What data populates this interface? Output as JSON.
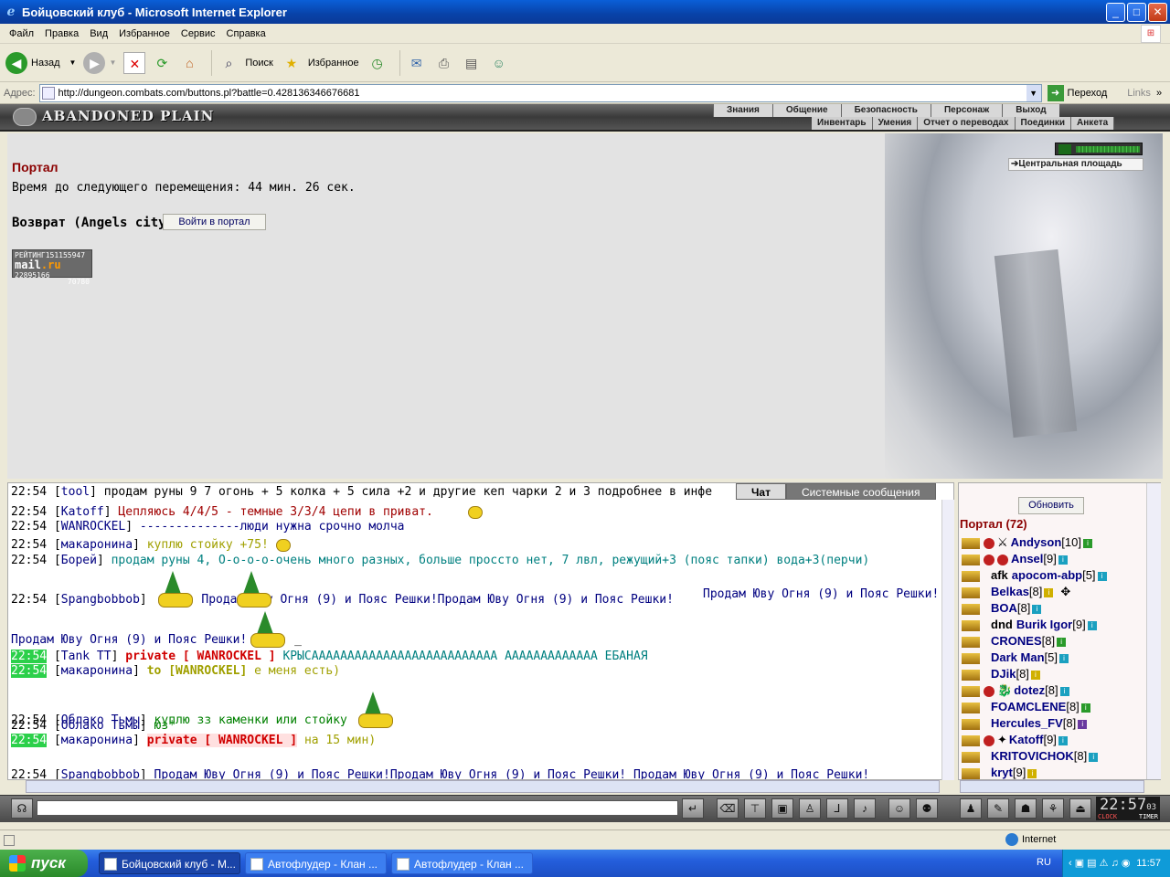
{
  "window": {
    "title": "Бойцовский клуб - Microsoft Internet Explorer",
    "min": "_",
    "max": "□",
    "close": "✕"
  },
  "menu": [
    "Файл",
    "Правка",
    "Вид",
    "Избранное",
    "Сервис",
    "Справка"
  ],
  "toolbar": {
    "back": "Назад",
    "search": "Поиск",
    "favorites": "Избранное"
  },
  "address": {
    "label": "Адрес:",
    "url": "http://dungeon.combats.com/buttons.pl?battle=0.428136346676681",
    "go": "Переход",
    "links": "Links"
  },
  "game": {
    "logo": "ABANDONED PLAIN",
    "nav_top": [
      "Знания",
      "Общение",
      "Безопасность",
      "Персонаж",
      "Выход"
    ],
    "nav_bottom": [
      "Инвентарь",
      "Умения",
      "Отчет о переводах",
      "Поединки",
      "Анкета"
    ]
  },
  "main": {
    "title": "Портал",
    "time_text": "Время до следующего перемещения: 44 мин. 26 сек.",
    "return_label": "Возврат (Angels city)",
    "portal_button": "Войти в портал",
    "central_link": "Центральная площадь",
    "counter": {
      "rating": "РЕЙТИНГ",
      "num1": "151155947",
      "brand": "mail",
      "brand_ru": ".ru",
      "num2": "22895166",
      "num3": "70780"
    }
  },
  "chat": {
    "tab_chat": "Чат",
    "tab_system": "Системные сообщения",
    "lines": [
      {
        "time": "22:54",
        "nick": "tool",
        "text": "продам руны 9 7 огонь + 5 колка + 5 сила +2 и другие кеп чарки 2 и 3 подробнее в инфе",
        "color": "#000000"
      },
      {
        "time": "22:54",
        "nick": "Katoff",
        "text": "Цепляюсь 4/4/5 - темные 3/3/4 цепи в приват.",
        "color": "#a00000"
      },
      {
        "time": "22:54",
        "nick": "WANROCKEL",
        "text": "--------------люди нужна срочно молча",
        "color": "#000080"
      },
      {
        "time": "22:54",
        "nick": "макаронина",
        "text": "куплю стойку +75!",
        "color": "#a0a000"
      },
      {
        "time": "22:54",
        "nick": "Борей",
        "text": "продам руны 4, О-о-о-о-очень много разных, больше проссто нет, 7 лвл, режущий+3 (пояс тапки) вода+3(перчи)",
        "color": "#008080"
      },
      {
        "time": "22:54",
        "nick": "Spangbobbob",
        "text": "Продам Юву Огня (9) и Пояс Решки!Продам Юву Огня (9) и Пояс Решки!",
        "text2": "Продам Юву Огня (9) и Пояс Решки!",
        "color": "#000080"
      },
      {
        "text": "Продам Юву Огня (9) и Пояс Решки!",
        "tail": "_",
        "color": "#000080"
      },
      {
        "time": "22:54",
        "nick": "Tank TT",
        "private": "private [ WANROCKEL ]",
        "text": "КРЫСАААААААААААААААААААААААААА ААААААААААААА ЕБАНАЯ",
        "color": "#008080"
      },
      {
        "time": "22:54",
        "nick": "макаронина",
        "to": "to [WANROCKEL]",
        "text": "е меня есть)",
        "color": "#a0a000"
      },
      {
        "time": "22:54",
        "nick": "Облако Тьмы",
        "text": "куплю зз каменки или стойку",
        "color": "#008000"
      },
      {
        "time": "22:54",
        "nick": "Облако Тьмы",
        "text": "юз*",
        "color": "#008000"
      },
      {
        "time": "22:54",
        "nick": "макаронина",
        "private": "private [ WANROCKEL ]",
        "text": "на 15 мин)",
        "color": "#a0a000"
      },
      {
        "time": "22:54",
        "nick": "Spangbobbob",
        "text": "Продам Юву Огня (9) и Пояс Решки!Продам Юву Огня (9) и Пояс Решки!",
        "text2": "Продам Юву Огня (9) и Пояс Решки!",
        "color": "#000080"
      }
    ]
  },
  "online": {
    "refresh": "Обновить",
    "title": "Портал (72)",
    "users": [
      {
        "name": "Andyson",
        "level": "[10]"
      },
      {
        "name": "Ansel",
        "level": "[9]"
      },
      {
        "status": "afk",
        "name": "apocom-abp",
        "level": "[5]"
      },
      {
        "name": "Belkas",
        "level": "[8]"
      },
      {
        "name": "BOA",
        "level": "[8]"
      },
      {
        "status": "dnd",
        "name": "Burik Igor",
        "level": "[9]"
      },
      {
        "name": "CRONES",
        "level": "[8]"
      },
      {
        "name": "Dark Man",
        "level": "[5]"
      },
      {
        "name": "DJik",
        "level": "[8]"
      },
      {
        "name": "dotez",
        "level": "[8]"
      },
      {
        "name": "FOAMCLENE",
        "level": "[8]"
      },
      {
        "name": "Hercules_FV",
        "level": "[8]"
      },
      {
        "name": "Katoff",
        "level": "[9]"
      },
      {
        "name": "KRITOVICHOK",
        "level": "[8]"
      },
      {
        "name": "kryt",
        "level": "[9]"
      }
    ]
  },
  "clock": {
    "time": "22:57",
    "sec": "03",
    "label1": "CLOCK",
    "label2": "TIMER"
  },
  "status": {
    "zone": "Internet"
  },
  "taskbar": {
    "start": "пуск",
    "tasks": [
      "Бойцовский клуб - M...",
      "Автофлудер - Клан ...",
      "Автофлудер - Клан ..."
    ],
    "lang": "RU",
    "time": "11:57"
  }
}
